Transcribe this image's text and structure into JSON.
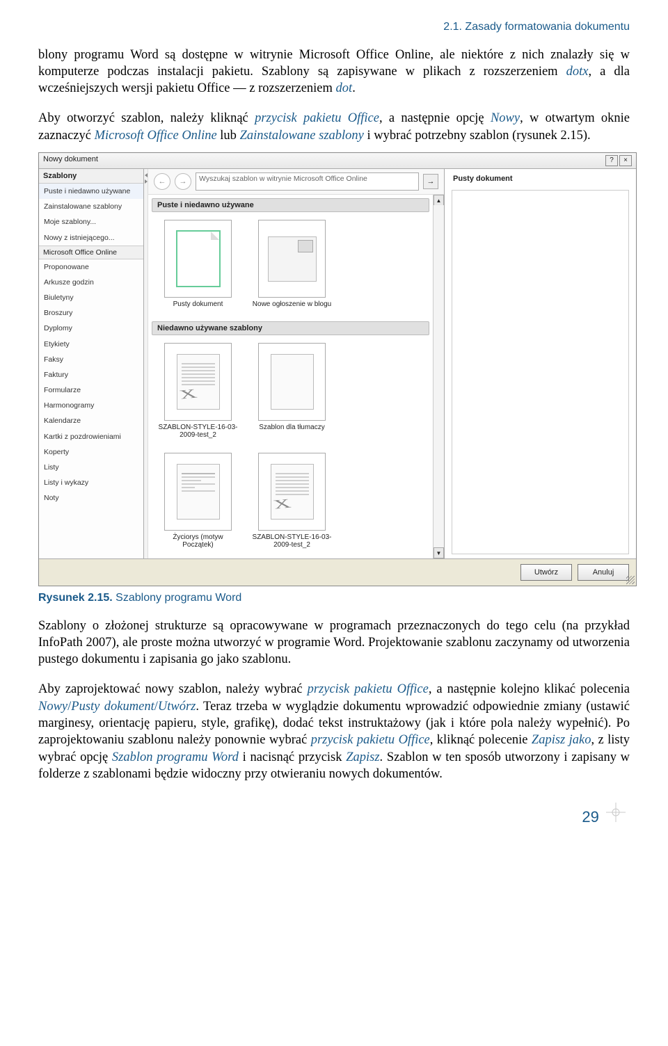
{
  "header": {
    "section": "2.1. Zasady formatowania dokumentu"
  },
  "para1": {
    "a": "blony programu Word są dostępne w witrynie Microsoft Office Online, ale niektóre z nich znalazły się w komputerze podczas instalacji pakietu. Szablony są zapisywane w plikach z rozszerzeniem ",
    "dotx": "dotx",
    "b": ", a dla wcześniejszych wersji pakietu Office — z rozszerzeniem ",
    "dot": "dot",
    "c": "."
  },
  "para2": {
    "a": "Aby otworzyć szablon, należy kliknąć ",
    "p1": "przycisk pakietu Office",
    "b": ", a następnie opcję ",
    "p2": "Nowy",
    "c": ", w otwartym oknie zaznaczyć ",
    "p3": "Microsoft Office Online",
    "d": " lub ",
    "p4": "Zainstalowane szablony",
    "e": " i wybrać potrzebny szablon (rysunek 2.15)."
  },
  "dialog": {
    "title": "Nowy dokument",
    "help": "?",
    "close": "×",
    "left": {
      "header": "Szablony",
      "i1": "Puste i niedawno używane",
      "i2": "Zainstalowane szablony",
      "i3": "Moje szablony...",
      "i4": "Nowy z istniejącego...",
      "section_online": "Microsoft Office Online",
      "o1": "Proponowane",
      "o2": "Arkusze godzin",
      "o3": "Biuletyny",
      "o4": "Broszury",
      "o5": "Dyplomy",
      "o6": "Etykiety",
      "o7": "Faksy",
      "o8": "Faktury",
      "o9": "Formularze",
      "o10": "Harmonogramy",
      "o11": "Kalendarze",
      "o12": "Kartki z pozdrowieniami",
      "o13": "Koperty",
      "o14": "Listy",
      "o15": "Listy i wykazy",
      "o16": "Noty"
    },
    "center": {
      "back": "←",
      "fwd": "→",
      "search_placeholder": "Wyszukaj szablon w witrynie Microsoft Office Online",
      "go": "→",
      "section1": "Puste i niedawno używane",
      "t1": "Pusty dokument",
      "t2": "Nowe ogłoszenie w blogu",
      "section2": "Niedawno używane szablony",
      "t3": "SZABLON-STYLE-16-03-2009-test_2",
      "t4": "Szablon dla tłumaczy",
      "t5": "Życiorys (motyw Początek)",
      "t6": "SZABLON-STYLE-16-03-2009-test_2"
    },
    "right": {
      "title": "Pusty dokument"
    },
    "btn_create": "Utwórz",
    "btn_cancel": "Anuluj"
  },
  "caption": {
    "label": "Rysunek 2.15.",
    "text": " Szablony programu Word"
  },
  "para3": "Szablony o złożonej strukturze są opracowywane w programach przeznaczonych do tego celu (na przykład InfoPath 2007), ale proste można utworzyć w programie Word. Projektowanie szablonu zaczynamy od utworzenia pustego dokumentu i zapisania go jako szablonu.",
  "para4": {
    "a": "Aby zaprojektować nowy szablon, należy wybrać ",
    "p1": "przycisk pakietu Office",
    "b": ", a następnie kolejno klikać polecenia ",
    "p2": "Nowy",
    "s1": "/",
    "p3": "Pusty dokument",
    "s2": "/",
    "p4": "Utwórz",
    "c": ". Teraz trzeba w wyglądzie dokumentu wprowadzić odpowiednie zmiany (ustawić marginesy, orientację papieru, style, grafikę), dodać tekst instruktażowy (jak i które pola należy wypełnić). Po zaprojektowaniu szablonu należy ponownie wybrać ",
    "p5": "przycisk pakietu Office",
    "d": ", kliknąć polecenie ",
    "p6": "Zapisz jako",
    "e": ", z listy wybrać opcję ",
    "p7": "Szablon programu Word",
    "f": " i nacisnąć przycisk ",
    "p8": "Zapisz",
    "g": ". Szablon w ten sposób utworzony i zapisany w folderze z szablonami będzie widoczny przy otwieraniu nowych dokumentów."
  },
  "page_number": "29"
}
